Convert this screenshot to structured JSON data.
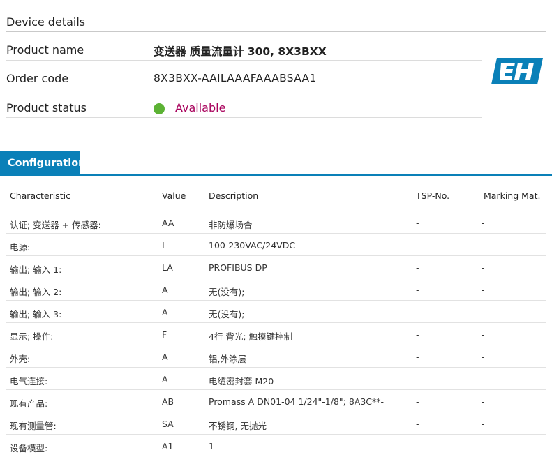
{
  "device": {
    "section_title": "Device details",
    "product_name_label": "Product name",
    "product_name_value": "变送器 质量流量计 300, 8X3BXX",
    "order_code_label": "Order code",
    "order_code_value": "8X3BXX-AAILAAAFAAABSAA1",
    "product_status_label": "Product status",
    "product_status_value": "Available",
    "status_color": "#5cb234",
    "logo_icon": "endress-hauser-logo"
  },
  "config": {
    "tab_label": "Configuration",
    "accent_color": "#0a80b8",
    "columns": {
      "characteristic": "Characteristic",
      "value": "Value",
      "description": "Description",
      "tsp": "TSP-No.",
      "marking": "Marking Mat."
    },
    "rows": [
      {
        "characteristic": "认证; 变送器 + 传感器:",
        "value": "AA",
        "description": "非防爆场合",
        "tsp": "-",
        "marking": "-"
      },
      {
        "characteristic": "电源:",
        "value": "I",
        "description": "100-230VAC/24VDC",
        "tsp": "-",
        "marking": "-"
      },
      {
        "characteristic": "输出; 输入 1:",
        "value": "LA",
        "description": "PROFIBUS DP",
        "tsp": "-",
        "marking": "-"
      },
      {
        "characteristic": "输出; 输入 2:",
        "value": "A",
        "description": "无(没有);",
        "tsp": "-",
        "marking": "-"
      },
      {
        "characteristic": "输出; 输入 3:",
        "value": "A",
        "description": "无(没有);",
        "tsp": "-",
        "marking": "-"
      },
      {
        "characteristic": "显示; 操作:",
        "value": "F",
        "description": "4行 背光; 触摸键控制",
        "tsp": "-",
        "marking": "-"
      },
      {
        "characteristic": "外壳:",
        "value": "A",
        "description": "铝,外涂层",
        "tsp": "-",
        "marking": "-"
      },
      {
        "characteristic": "电气连接:",
        "value": "A",
        "description": "电缆密封套 M20",
        "tsp": "-",
        "marking": "-"
      },
      {
        "characteristic": "现有产品:",
        "value": "AB",
        "description": "Promass A DN01-04 1/24\"-1/8\"; 8A3C**-",
        "tsp": "-",
        "marking": "-"
      },
      {
        "characteristic": "现有测量管:",
        "value": "SA",
        "description": "不锈钢, 无抛光",
        "tsp": "-",
        "marking": "-"
      },
      {
        "characteristic": "设备模型:",
        "value": "A1",
        "description": "1",
        "tsp": "-",
        "marking": "-"
      }
    ]
  }
}
